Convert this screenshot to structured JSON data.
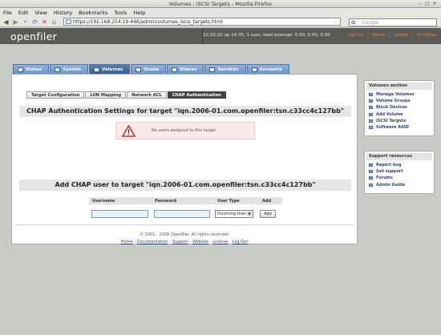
{
  "browser": {
    "title": "Volumes : iSCSI Targets - Mozilla Firefox",
    "menu": [
      "File",
      "Edit",
      "View",
      "History",
      "Bookmarks",
      "Tools",
      "Help"
    ],
    "url": "https://192.168.254.19:446/admin/volumes_iscsi_targets.html",
    "search_placeholder": "Google"
  },
  "app": {
    "logo": "openfiler",
    "status": "22:32:20 up 14:35, 1 user, load average: 0.00, 0.00, 0.00",
    "header_links": [
      "Log Out",
      "Status",
      "Update",
      "Shutdown"
    ],
    "tabs": [
      "Status",
      "System",
      "Volumes",
      "Quota",
      "Shares",
      "Services",
      "Accounts"
    ],
    "active_tab": "Volumes",
    "subtabs": [
      "Target Configuration",
      "LUN Mapping",
      "Network ACL",
      "CHAP Authentication"
    ],
    "active_subtab": "CHAP Authentication"
  },
  "chap": {
    "heading": "CHAP Authentication Settings for target \"iqn.2006-01.com.openfiler:tsn.c33cc4c127bb\"",
    "alert": "No users assigned to this target."
  },
  "adduser": {
    "heading": "Add CHAP user to target \"iqn.2006-01.com.openfiler:tsn.c33cc4c127bb\"",
    "col_username": "Username",
    "col_password": "Password",
    "col_usertype": "User Type",
    "col_add": "Add",
    "usertype_value": "Incoming User",
    "add_label": "Add"
  },
  "sidebar": {
    "volumes_title": "Volumes section",
    "volumes_items": [
      "Manage Volumes",
      "Volume Groups",
      "Block Devices",
      "Add Volume",
      "iSCSI Targets",
      "Software RAID"
    ],
    "support_title": "Support resources",
    "support_items": [
      "Report bug",
      "Get support",
      "Forums",
      "Admin Guide"
    ]
  },
  "footer": {
    "copyright": "© 2001 - 2008 Openfiler. All rights reserved.",
    "links": [
      "Home",
      "Documentation",
      "Support",
      "Website",
      "License",
      "Log Out"
    ]
  }
}
